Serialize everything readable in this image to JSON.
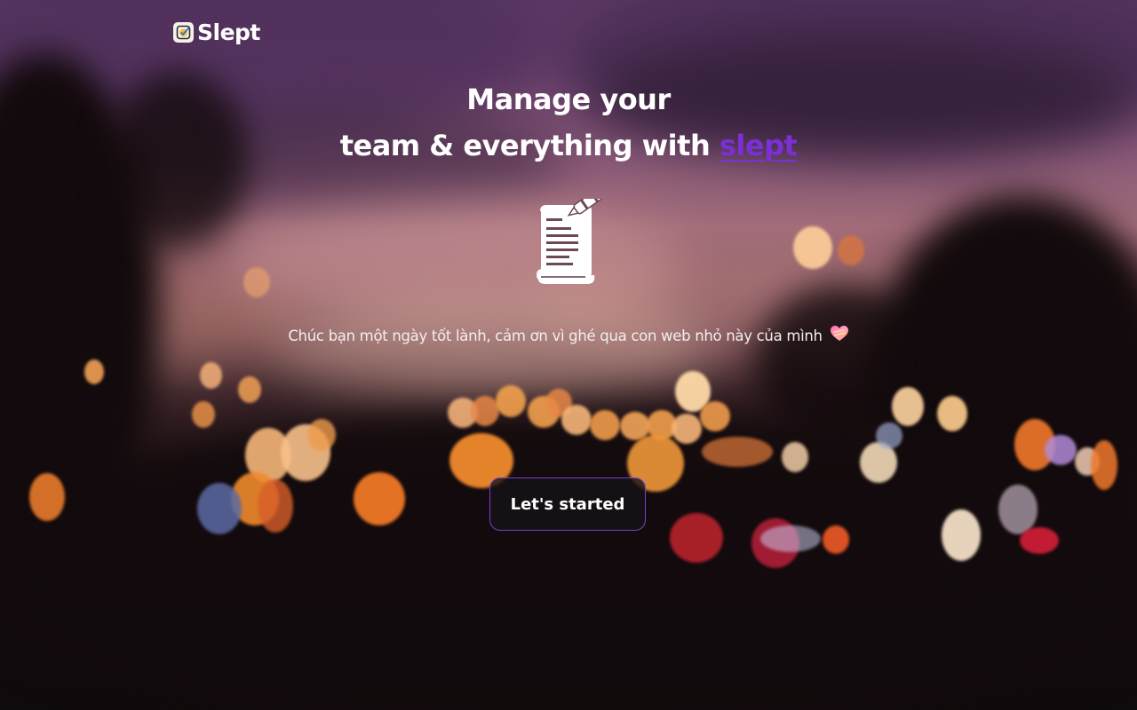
{
  "brand": {
    "name": "Slept",
    "icon": "checklist-logo-icon"
  },
  "hero": {
    "headline_line1": "Manage your",
    "headline_line2_prefix": "team & everything with ",
    "headline_accent": "slept",
    "illustration_icon": "scroll-quill-icon",
    "subtitle": "Chúc bạn một ngày tốt lành, cảm ơn vì ghé qua con web nhỏ này của mình",
    "subtitle_emoji_icon": "sparkling-heart-icon",
    "cta_label": "Let's started"
  },
  "colors": {
    "accent": "#7b2fd6",
    "text": "#ffffff",
    "button_border": "#7a3ec8"
  }
}
